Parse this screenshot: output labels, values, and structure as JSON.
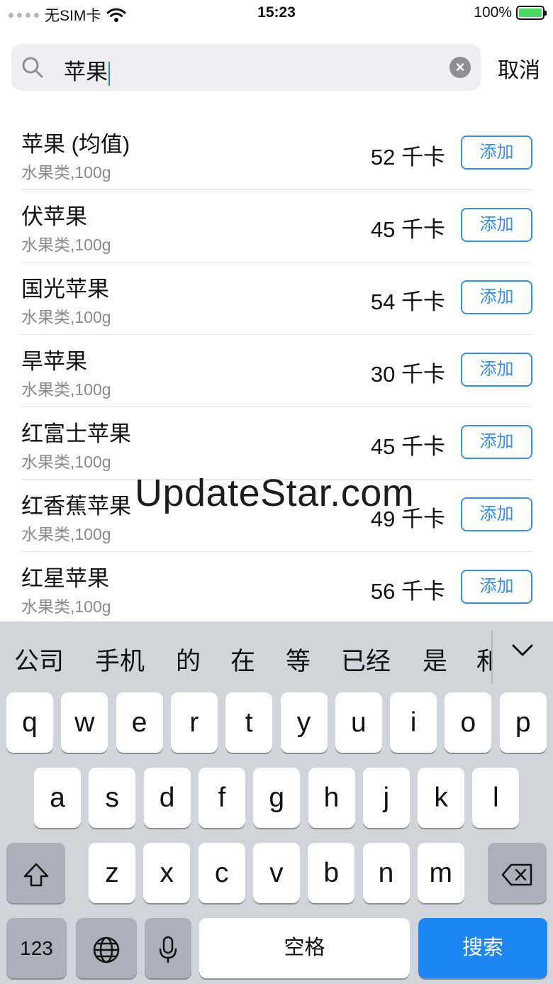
{
  "status_bar": {
    "carrier": "无SIM卡",
    "time": "15:23",
    "battery": "100%"
  },
  "search": {
    "value": "苹果",
    "cancel_label": "取消"
  },
  "results": [
    {
      "name": "苹果 (均值)",
      "category": "水果类,100g",
      "calories": "52 千卡",
      "add_label": "添加"
    },
    {
      "name": "伏苹果",
      "category": "水果类,100g",
      "calories": "45 千卡",
      "add_label": "添加"
    },
    {
      "name": "国光苹果",
      "category": "水果类,100g",
      "calories": "54 千卡",
      "add_label": "添加"
    },
    {
      "name": "旱苹果",
      "category": "水果类,100g",
      "calories": "30 千卡",
      "add_label": "添加"
    },
    {
      "name": "红富士苹果",
      "category": "水果类,100g",
      "calories": "45 千卡",
      "add_label": "添加"
    },
    {
      "name": "红香蕉苹果",
      "category": "水果类,100g",
      "calories": "49 千卡",
      "add_label": "添加"
    },
    {
      "name": "红星苹果",
      "category": "水果类,100g",
      "calories": "56 千卡",
      "add_label": "添加"
    }
  ],
  "watermark": "UpdateStar.com",
  "keyboard": {
    "candidates": [
      "公司",
      "手机",
      "的",
      "在",
      "等",
      "已经",
      "是",
      "和"
    ],
    "row1": [
      "q",
      "w",
      "e",
      "r",
      "t",
      "y",
      "u",
      "i",
      "o",
      "p"
    ],
    "row2": [
      "a",
      "s",
      "d",
      "f",
      "g",
      "h",
      "j",
      "k",
      "l"
    ],
    "row3": [
      "z",
      "x",
      "c",
      "v",
      "b",
      "n",
      "m"
    ],
    "numbers_label": "123",
    "space_label": "空格",
    "search_label": "搜索",
    "colors": {
      "background": "#d1d4db",
      "key": "#ffffff",
      "dark_key": "#abb0ba",
      "action": "#1e86f2"
    }
  }
}
